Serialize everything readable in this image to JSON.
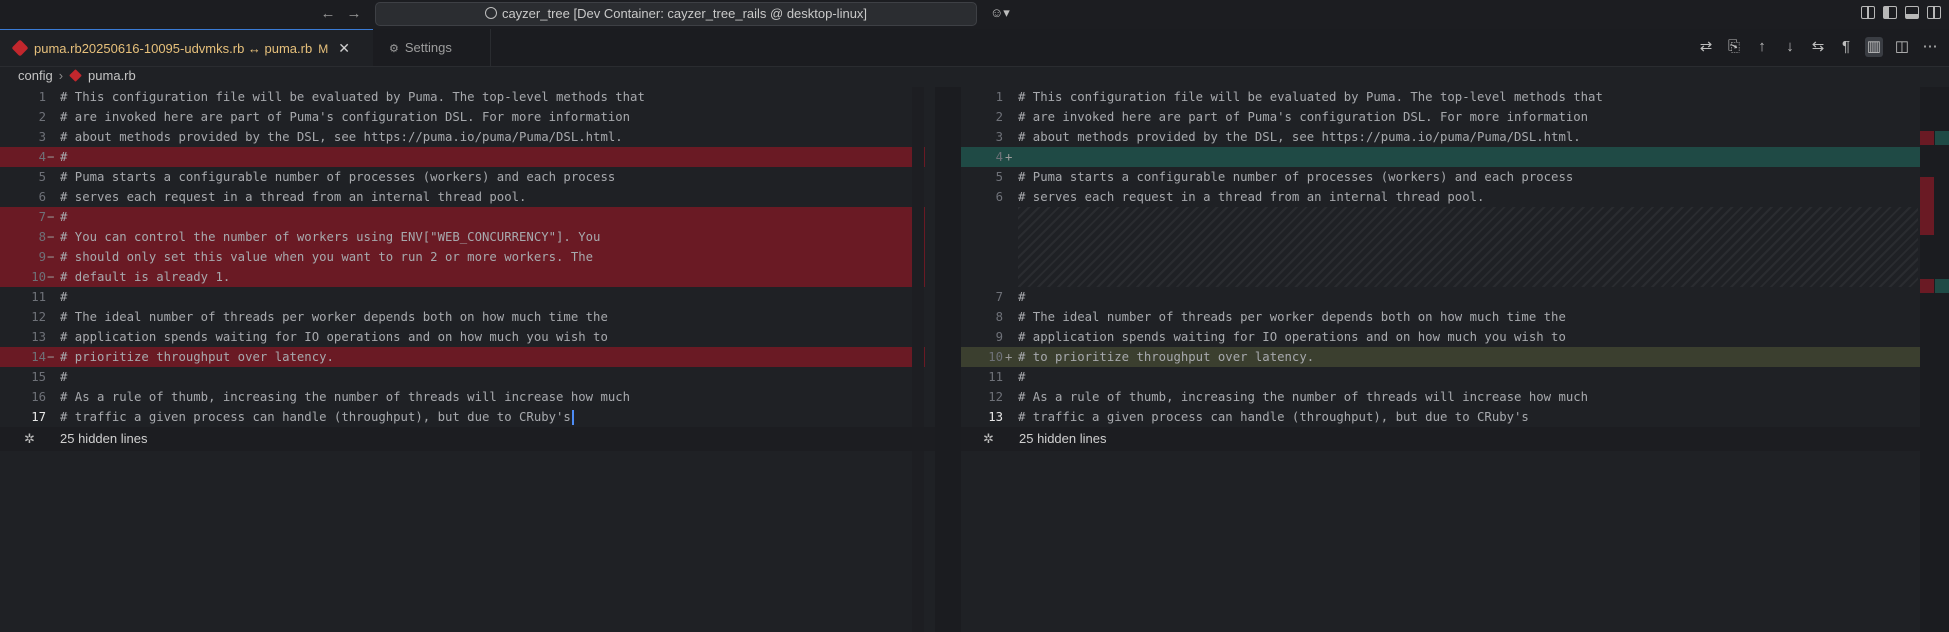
{
  "titlebar": {
    "back": "←",
    "forward": "→",
    "command_center": "cayzer_tree [Dev Container: cayzer_tree_rails @ desktop-linux]"
  },
  "tabs": [
    {
      "label": "puma.rb20250616-10095-udvmks.rb ↔ puma.rb",
      "modified": "M",
      "close": "✕"
    },
    {
      "label": "Settings"
    }
  ],
  "breadcrumb": {
    "folder": "config",
    "file": "puma.rb"
  },
  "left_lines": [
    {
      "n": "1",
      "m": "",
      "t": "# This configuration file will be evaluated by Puma. The top-level methods that"
    },
    {
      "n": "2",
      "m": "",
      "t": "# are invoked here are part of Puma's configuration DSL. For more information"
    },
    {
      "n": "3",
      "m": "",
      "t": "# about methods provided by the DSL, see https://puma.io/puma/Puma/DSL.html."
    },
    {
      "n": "4",
      "m": "−",
      "t": "#"
    },
    {
      "n": "5",
      "m": "",
      "t": "# Puma starts a configurable number of processes (workers) and each process"
    },
    {
      "n": "6",
      "m": "",
      "t": "# serves each request in a thread from an internal thread pool."
    },
    {
      "n": "7",
      "m": "−",
      "t": "#"
    },
    {
      "n": "8",
      "m": "−",
      "t": "# You can control the number of workers using ENV[\"WEB_CONCURRENCY\"]. You"
    },
    {
      "n": "9",
      "m": "−",
      "t": "# should only set this value when you want to run 2 or more workers. The"
    },
    {
      "n": "10",
      "m": "−",
      "t": "# default is already 1."
    },
    {
      "n": "11",
      "m": "",
      "t": "#"
    },
    {
      "n": "12",
      "m": "",
      "t": "# The ideal number of threads per worker depends both on how much time the"
    },
    {
      "n": "13",
      "m": "",
      "t": "# application spends waiting for IO operations and on how much you wish to"
    },
    {
      "n": "14",
      "m": "−",
      "t": "# prioritize throughput over latency."
    },
    {
      "n": "15",
      "m": "",
      "t": "#"
    },
    {
      "n": "16",
      "m": "",
      "t": "# As a rule of thumb, increasing the number of threads will increase how much"
    },
    {
      "n": "17",
      "m": "",
      "t": "# traffic a given process can handle (throughput), but due to CRuby's"
    }
  ],
  "right_lines": [
    {
      "n": "1",
      "m": "",
      "t": "# This configuration file will be evaluated by Puma. The top-level methods that"
    },
    {
      "n": "2",
      "m": "",
      "t": "# are invoked here are part of Puma's configuration DSL. For more information"
    },
    {
      "n": "3",
      "m": "",
      "t": "# about methods provided by the DSL, see https://puma.io/puma/Puma/DSL.html."
    },
    {
      "n": "4",
      "m": "+",
      "t": ""
    },
    {
      "n": "5",
      "m": "",
      "t": "# Puma starts a configurable number of processes (workers) and each process"
    },
    {
      "n": "6",
      "m": "",
      "t": "# serves each request in a thread from an internal thread pool."
    },
    {
      "n": "7",
      "m": "",
      "t": "#"
    },
    {
      "n": "8",
      "m": "",
      "t": "# The ideal number of threads per worker depends both on how much time the"
    },
    {
      "n": "9",
      "m": "",
      "t": "# application spends waiting for IO operations and on how much you wish to"
    },
    {
      "n": "10",
      "m": "+",
      "t": "# to prioritize throughput over latency."
    },
    {
      "n": "11",
      "m": "",
      "t": "#"
    },
    {
      "n": "12",
      "m": "",
      "t": "# As a rule of thumb, increasing the number of threads will increase how much"
    },
    {
      "n": "13",
      "m": "",
      "t": "# traffic a given process can handle (throughput), but due to CRuby's"
    }
  ],
  "hidden_left": "25 hidden lines",
  "hidden_right": "25 hidden lines",
  "colors": {
    "deleted": "#6a1a24",
    "added": "#1f4a45",
    "changed": "#3b3f2f",
    "accent": "#3a7bd5"
  }
}
